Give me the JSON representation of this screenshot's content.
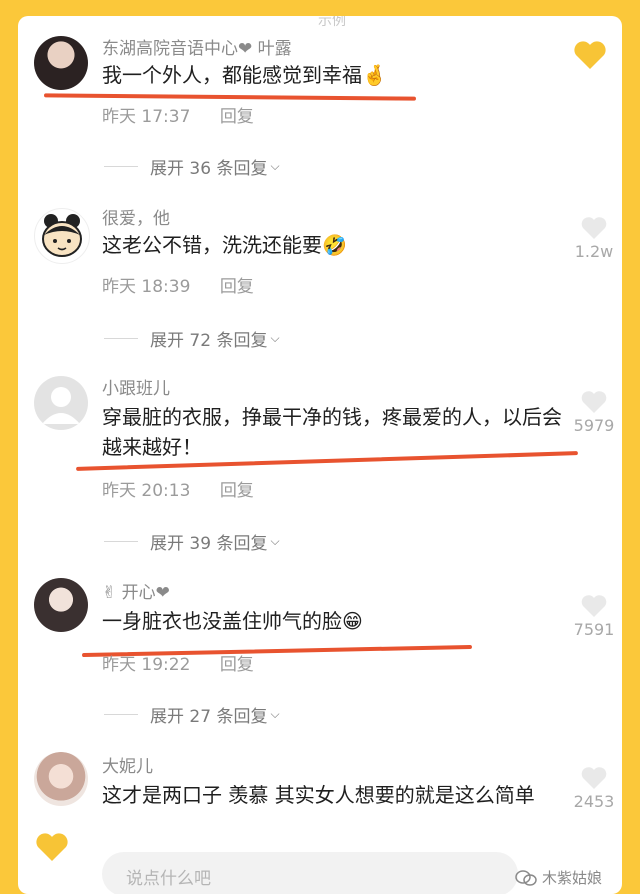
{
  "top_partial_text": "示例",
  "comments": [
    {
      "username": "东湖高院音语中心❤ 叶露",
      "text": "我一个外人，都能感觉到幸福🤞",
      "time": "昨天 17:37",
      "reply_label": "回复",
      "expand_label": "展开 36 条回复",
      "likes": ""
    },
    {
      "username": "很爱，他",
      "text": "这老公不错，洗洗还能要🤣",
      "time": "昨天 18:39",
      "reply_label": "回复",
      "expand_label": "展开 72 条回复",
      "likes": "1.2w"
    },
    {
      "username": "小跟班儿",
      "text": "穿最脏的衣服，挣最干净的钱，疼最爱的人，以后会越来越好！",
      "time": "昨天 20:13",
      "reply_label": "回复",
      "expand_label": "展开 39 条回复",
      "likes": "5979"
    },
    {
      "username": "✌ 开心❤",
      "text": "一身脏衣也没盖住帅气的脸😁",
      "time": "昨天 19:22",
      "reply_label": "回复",
      "expand_label": "展开 27 条回复",
      "likes": "7591"
    },
    {
      "username": "大妮儿",
      "text": "这才是两口子 羡慕 其实女人想要的就是这么简单",
      "time": "",
      "reply_label": "",
      "expand_label": "",
      "likes": "2453"
    }
  ],
  "input_placeholder": "说点什么吧",
  "watermark": "木紫姑娘",
  "colors": {
    "frame": "#FBC83A",
    "underline": "#E8532F",
    "heart": "#F7C436"
  },
  "icons": [
    "heart-outline-icon",
    "favorite-heart-icon",
    "chevron-down-icon",
    "wechat-icon"
  ]
}
